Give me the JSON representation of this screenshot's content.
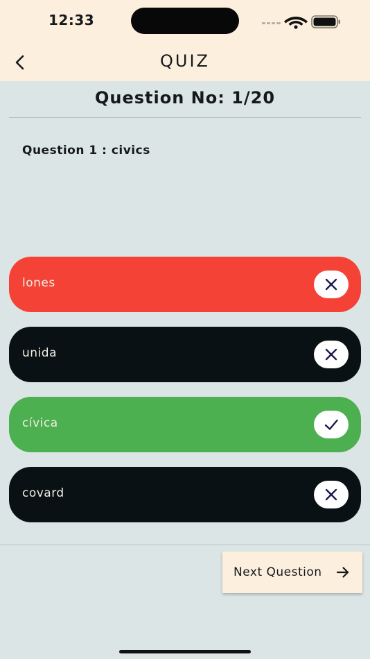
{
  "status_bar": {
    "time": "12:33"
  },
  "header": {
    "title": "QUIZ"
  },
  "question_no": "Question No: 1/20",
  "question_text": "Question 1 : civics",
  "options": [
    {
      "label": "lones",
      "state": "wrong-selected",
      "color": "#f44336",
      "icon": "close-icon"
    },
    {
      "label": "unida",
      "state": "neutral",
      "color": "#091114",
      "icon": "close-icon"
    },
    {
      "label": "cívica",
      "state": "correct",
      "color": "#4caf50",
      "icon": "check-icon"
    },
    {
      "label": "covard",
      "state": "neutral",
      "color": "#091114",
      "icon": "close-icon"
    }
  ],
  "next_button": {
    "label": "Next Question",
    "icon": "arrow-right-icon"
  },
  "colors": {
    "header_bg": "#fcefdd",
    "page_bg": "#dce5e6",
    "mark_icon": "#1d1850"
  }
}
